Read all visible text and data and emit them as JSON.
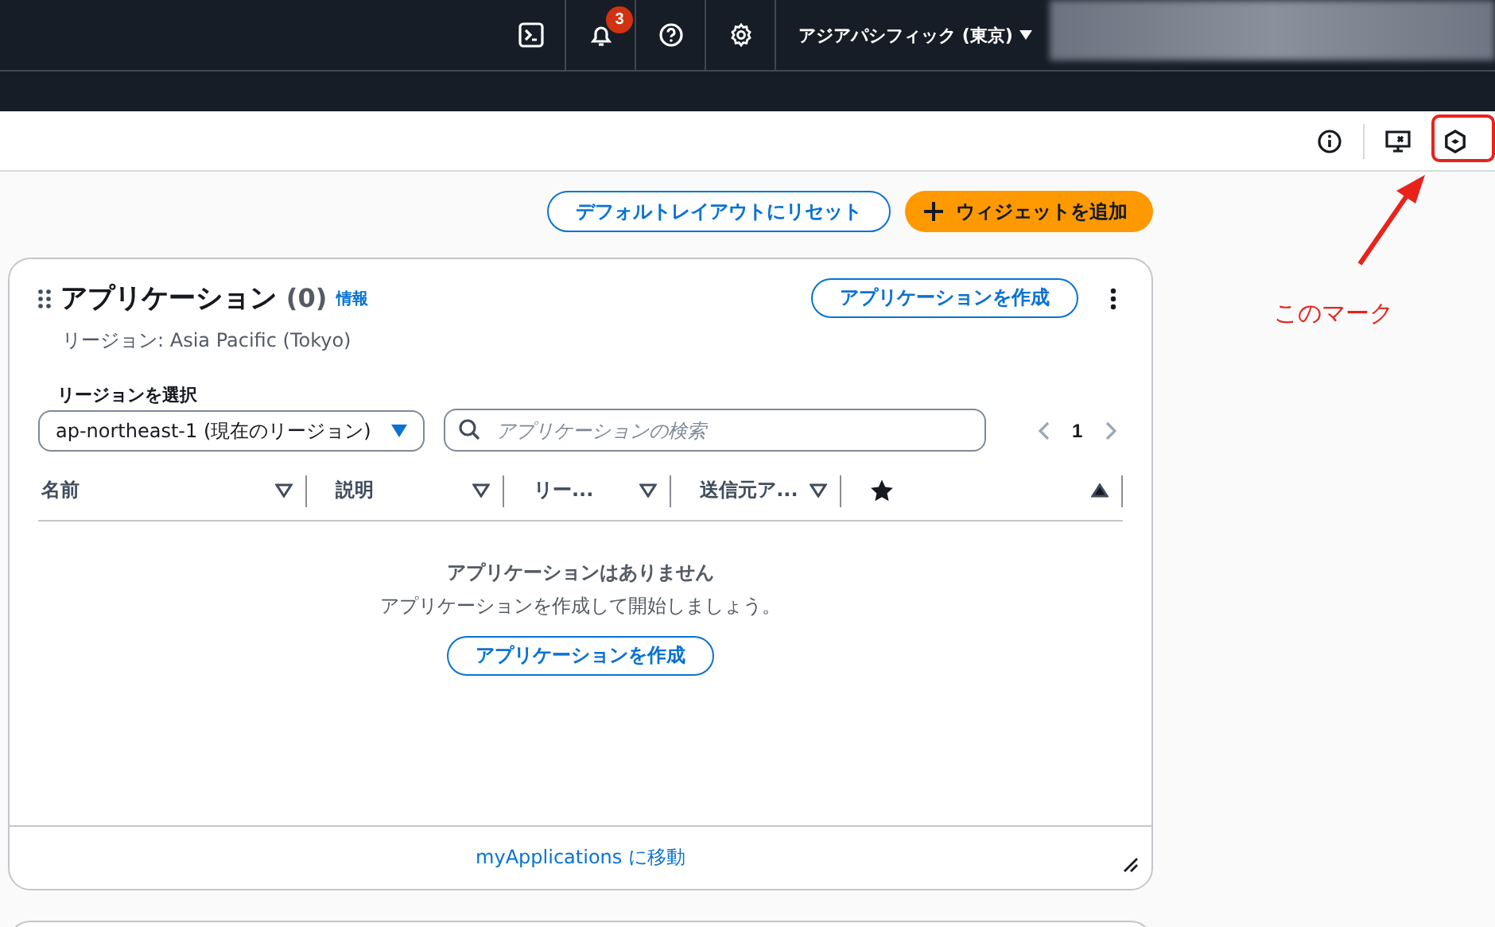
{
  "top_nav": {
    "notifications_count": "3",
    "region": "アジアパシフィック (東京)"
  },
  "toolbar_buttons": [
    "デフォルトレイアウトにリセット",
    "ウィジェットを追加"
  ],
  "widget": {
    "title": "アプリケーション",
    "count": "(0)",
    "info_link": "情報",
    "subtitle": "リージョン: Asia Pacific (Tokyo)",
    "create_button": "アプリケーションを作成",
    "region_select": {
      "label": "リージョンを選択",
      "value": "ap-northeast-1 (現在のリージョン)"
    },
    "search": {
      "placeholder": "アプリケーションの検索"
    },
    "pagination": {
      "page": "1"
    },
    "columns": [
      {
        "kind": "text",
        "label": "名前",
        "sorted": false
      },
      {
        "kind": "text",
        "label": "説明",
        "sorted": false
      },
      {
        "kind": "text",
        "label": "リー...",
        "sorted": false
      },
      {
        "kind": "text",
        "label": "送信元ア...",
        "sorted": false
      },
      {
        "kind": "star",
        "sorted": true
      }
    ],
    "empty": {
      "title": "アプリケーションはありません",
      "message": "アプリケーションを作成して開始しましょう。",
      "button": "アプリケーションを作成"
    },
    "footer_link": "myApplications に移動"
  },
  "annotation": {
    "text": "このマーク"
  }
}
